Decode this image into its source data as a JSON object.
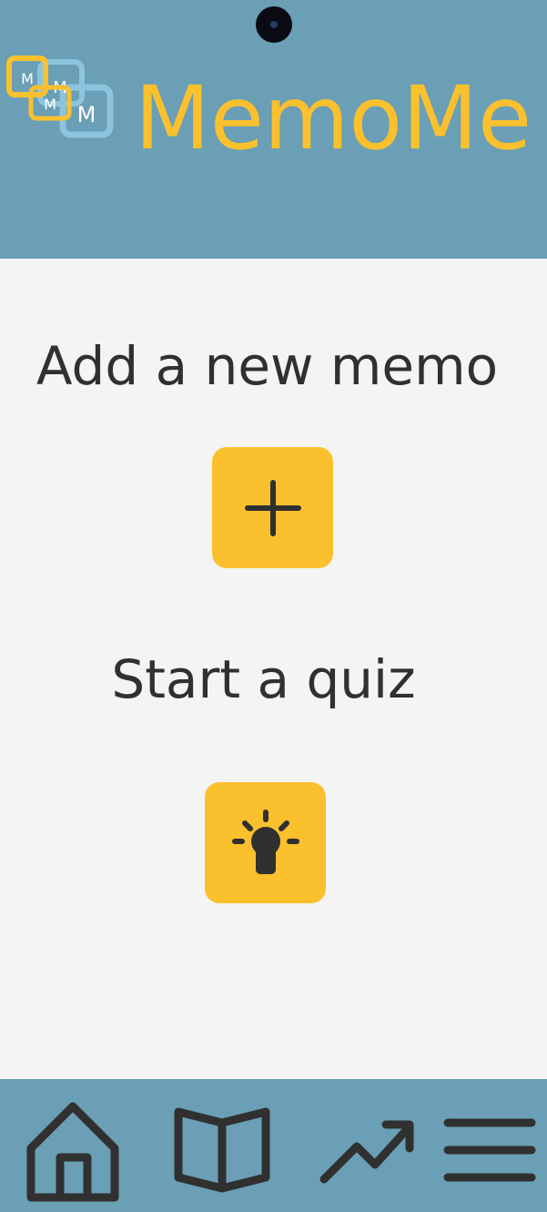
{
  "header": {
    "app_title": "MemoMe",
    "logo_letters": [
      "M",
      "M",
      "M",
      "M"
    ]
  },
  "main": {
    "add_memo_title": "Add a new memo",
    "add_memo_icon": "plus-icon",
    "quiz_title": "Start a quiz",
    "quiz_icon": "lightbulb-icon"
  },
  "nav": {
    "items": [
      {
        "name": "home",
        "icon": "home-icon"
      },
      {
        "name": "book",
        "icon": "open-book-icon"
      },
      {
        "name": "stats",
        "icon": "trending-up-icon"
      },
      {
        "name": "menu",
        "icon": "hamburger-menu-icon"
      }
    ]
  },
  "colors": {
    "header_bg": "#6a9fb5",
    "accent": "#fbc02d",
    "text": "#303030",
    "background": "#f4f4f4",
    "logo_blue": "#8cc4df"
  }
}
